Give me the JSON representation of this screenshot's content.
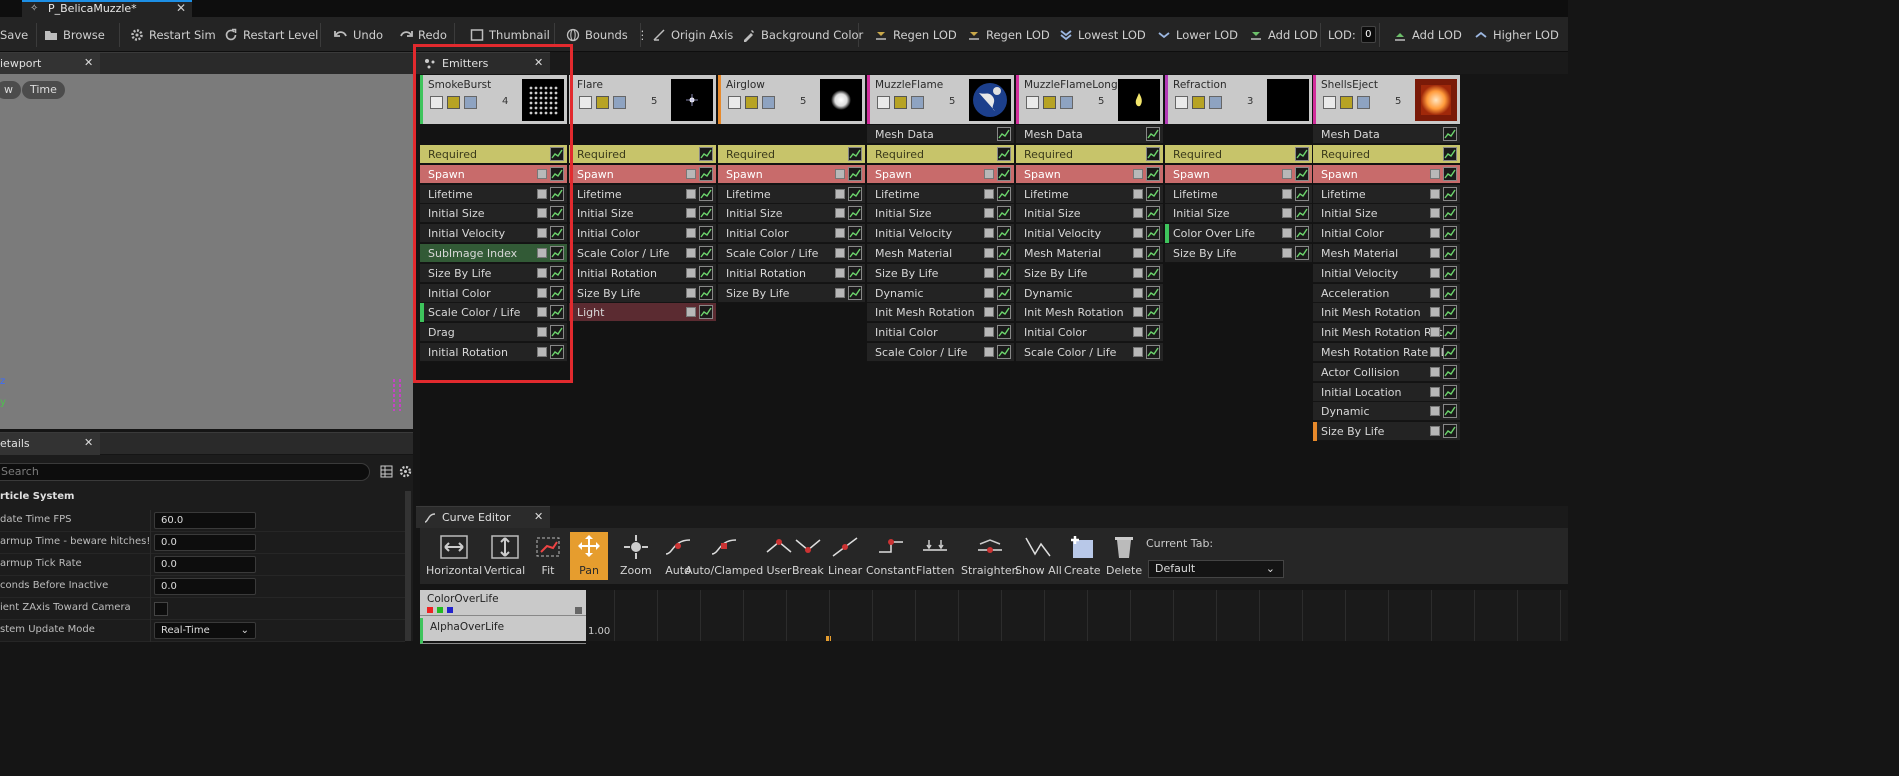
{
  "document_tab": {
    "title": "P_BelicaMuzzle*"
  },
  "toolbar": {
    "items": [
      "Save",
      "Browse",
      "Restart Sim",
      "Restart Level",
      "Undo",
      "Redo",
      "Thumbnail",
      "Bounds",
      "Origin Axis",
      "Background Color",
      "Regen LOD",
      "Regen LOD",
      "Lowest LOD",
      "Lower LOD",
      "Add LOD",
      "LOD:",
      "Add LOD",
      "Higher LOD"
    ],
    "lod_value": "0"
  },
  "viewport": {
    "tab_label": "iewport",
    "pill_left": "w",
    "pill_time": "Time",
    "axis_x": "z",
    "axis_y": "y"
  },
  "details": {
    "tab_label": "etails",
    "search_placeholder": "Search",
    "section": "rticle System",
    "rows": [
      {
        "name": "date Time FPS",
        "value": "60.0"
      },
      {
        "name": "armup Time - beware hitches!",
        "value": "0.0"
      },
      {
        "name": "armup Tick Rate",
        "value": "0.0"
      },
      {
        "name": "conds Before Inactive",
        "value": "0.0"
      },
      {
        "name": "ient ZAxis Toward Camera",
        "value": ""
      },
      {
        "name": "stem Update Mode",
        "value": "Real-Time"
      }
    ]
  },
  "emitters_panel": {
    "tab_label": "Emitters"
  },
  "emitters": [
    {
      "name": "SmokeBurst",
      "count": "4",
      "stripe": "#3ec45c",
      "thumb": "grid",
      "mesh_data": false,
      "modules": [
        "Required",
        "Spawn",
        "Lifetime",
        "Initial Size",
        "Initial Velocity",
        "SubImage Index",
        "Size By Life",
        "Initial Color",
        "Scale Color / Life",
        "Drag",
        "Initial Rotation"
      ]
    },
    {
      "name": "Flare",
      "count": "5",
      "stripe": "#c8c8c8",
      "thumb": "star",
      "mesh_data": false,
      "modules": [
        "Required",
        "Spawn",
        "Lifetime",
        "Initial Size",
        "Initial Color",
        "Scale Color / Life",
        "Initial Rotation",
        "Size By Life",
        "Light"
      ]
    },
    {
      "name": "Airglow",
      "count": "5",
      "stripe": "#e7892b",
      "thumb": "glow",
      "mesh_data": false,
      "modules": [
        "Required",
        "Spawn",
        "Lifetime",
        "Initial Size",
        "Initial Color",
        "Scale Color / Life",
        "Initial Rotation",
        "Size By Life"
      ]
    },
    {
      "name": "MuzzleFlame",
      "count": "5",
      "stripe": "#d22e9c",
      "thumb": "earth",
      "mesh_data": true,
      "modules": [
        "Required",
        "Spawn",
        "Lifetime",
        "Initial Size",
        "Initial Velocity",
        "Mesh Material",
        "Size By Life",
        "Dynamic",
        "Init Mesh Rotation",
        "Initial Color",
        "Scale Color / Life"
      ]
    },
    {
      "name": "MuzzleFlameLong",
      "count": "5",
      "stripe": "#d22e9c",
      "thumb": "flame",
      "mesh_data": true,
      "modules": [
        "Required",
        "Spawn",
        "Lifetime",
        "Initial Size",
        "Initial Velocity",
        "Mesh Material",
        "Size By Life",
        "Dynamic",
        "Init Mesh Rotation",
        "Initial Color",
        "Scale Color / Life"
      ]
    },
    {
      "name": "Refraction",
      "count": "3",
      "stripe": "#b43bb8",
      "thumb": "black",
      "mesh_data": false,
      "modules": [
        "Required",
        "Spawn",
        "Lifetime",
        "Initial Size",
        "Color Over Life",
        "Size By Life"
      ]
    },
    {
      "name": "ShellsEject",
      "count": "5",
      "stripe": "#d22e9c",
      "thumb": "orange",
      "mesh_data": true,
      "modules": [
        "Required",
        "Spawn",
        "Lifetime",
        "Initial Size",
        "Initial Color",
        "Mesh Material",
        "Initial Velocity",
        "Acceleration",
        "Init Mesh Rotation",
        "Init Mesh Rotation Rate",
        "Mesh Rotation Rate * L",
        "Actor Collision",
        "Initial Location",
        "Dynamic",
        "Size By Life"
      ]
    }
  ],
  "mesh_data_label": "Mesh Data",
  "curve_editor": {
    "tab_label": "Curve Editor",
    "buttons": [
      "Horizontal",
      "Vertical",
      "Fit",
      "Pan",
      "Zoom",
      "Auto",
      "Auto/Clamped",
      "User",
      "Break",
      "Linear",
      "Constant",
      "Flatten",
      "Straighten",
      "Show All",
      "Create",
      "Delete"
    ],
    "current_tab_label": "Current Tab:",
    "current_tab_value": "Default",
    "curves": [
      "ColorOverLife",
      "AlphaOverLife"
    ],
    "graph_label": "1.00"
  }
}
